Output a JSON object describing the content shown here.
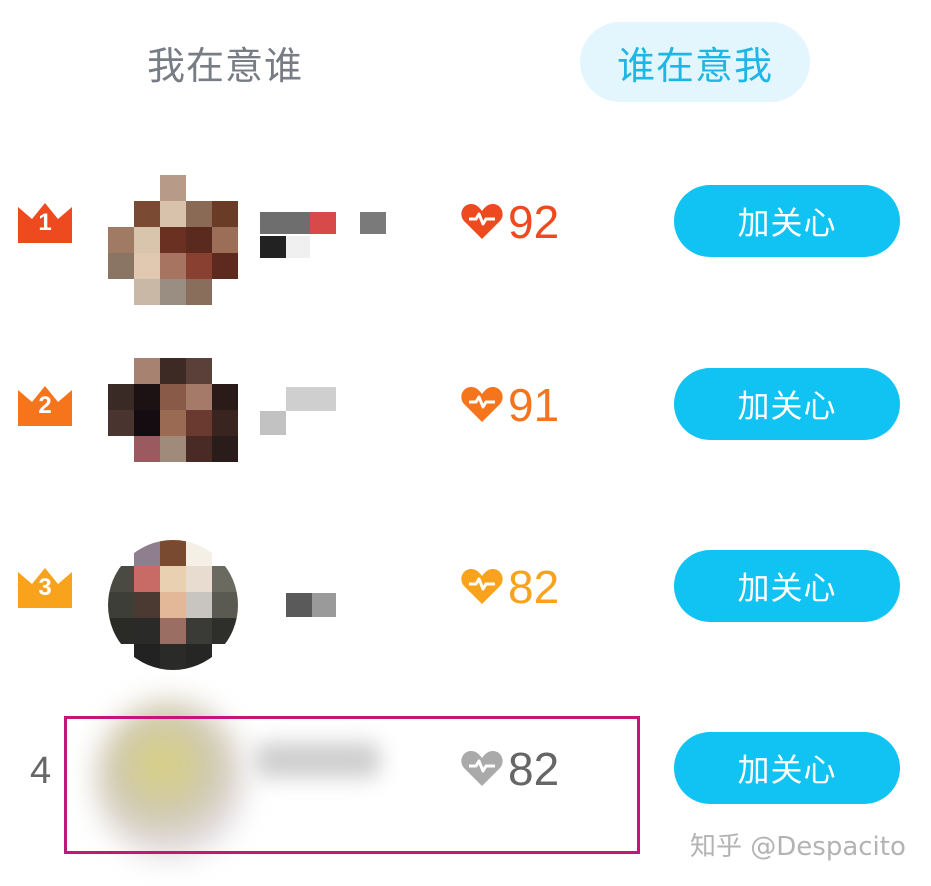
{
  "tabs": [
    {
      "label": "我在意谁",
      "active": false
    },
    {
      "label": "谁在意我",
      "active": true
    }
  ],
  "colors": {
    "accent": "#11c3f2",
    "tab_active_bg": "#e3f6fd",
    "tab_active_text": "#1fb6e6",
    "rank1": "#ee4a1f",
    "rank2": "#f5741c",
    "rank3": "#f9a21c",
    "rank_other": "#aaaaaa",
    "highlight_border": "#c2167a"
  },
  "rows": [
    {
      "rank": "1",
      "score": "92",
      "button_label": "加关心",
      "icon": "crown-icon",
      "heart_icon": "heart-icon"
    },
    {
      "rank": "2",
      "score": "91",
      "button_label": "加关心",
      "icon": "crown-icon",
      "heart_icon": "heart-icon"
    },
    {
      "rank": "3",
      "score": "82",
      "button_label": "加关心",
      "icon": "crown-icon",
      "heart_icon": "heart-icon"
    },
    {
      "rank": "4",
      "score": "82",
      "button_label": "加关心",
      "icon": "none",
      "heart_icon": "heart-icon"
    }
  ],
  "watermark": "知乎 @Despacito"
}
